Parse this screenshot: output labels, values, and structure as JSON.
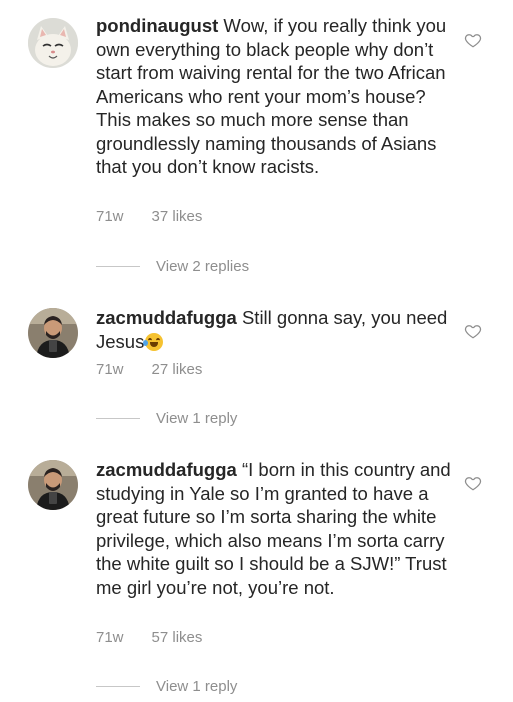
{
  "comments": [
    {
      "username": "pondinaugust",
      "text": " Wow, if you really think you own everything to black people why don’t start from waiving rental for the two African Americans who rent your mom’s house? This makes so much more sense than groundlessly naming thousands of Asians that you don’t know racists.",
      "time": "71w",
      "likes": "37 likes",
      "replies": "View 2 replies",
      "avatar": "cat-avatar"
    },
    {
      "username": "zacmuddafugga",
      "text": " Still gonna say, you need Jesus",
      "emoji": "rolling-on-floor-laughing",
      "time": "71w",
      "likes": "27 likes",
      "replies": "View 1 reply",
      "avatar": "person-avatar"
    },
    {
      "username": "zacmuddafugga",
      "text": " “I born in this country and studying in Yale so I’m granted to have a great future so I’m sorta sharing the white privilege, which also means I’m sorta carry the white guilt so I should be a SJW!” Trust me girl you’re not, you’re not.",
      "time": "71w",
      "likes": "57 likes",
      "replies": "View 1 reply",
      "avatar": "person-avatar"
    }
  ],
  "colors": {
    "text": "#262626",
    "secondary": "#8e8e8e",
    "divider": "#c7c7c7"
  },
  "icons": {
    "like": "heart-outline-icon"
  }
}
